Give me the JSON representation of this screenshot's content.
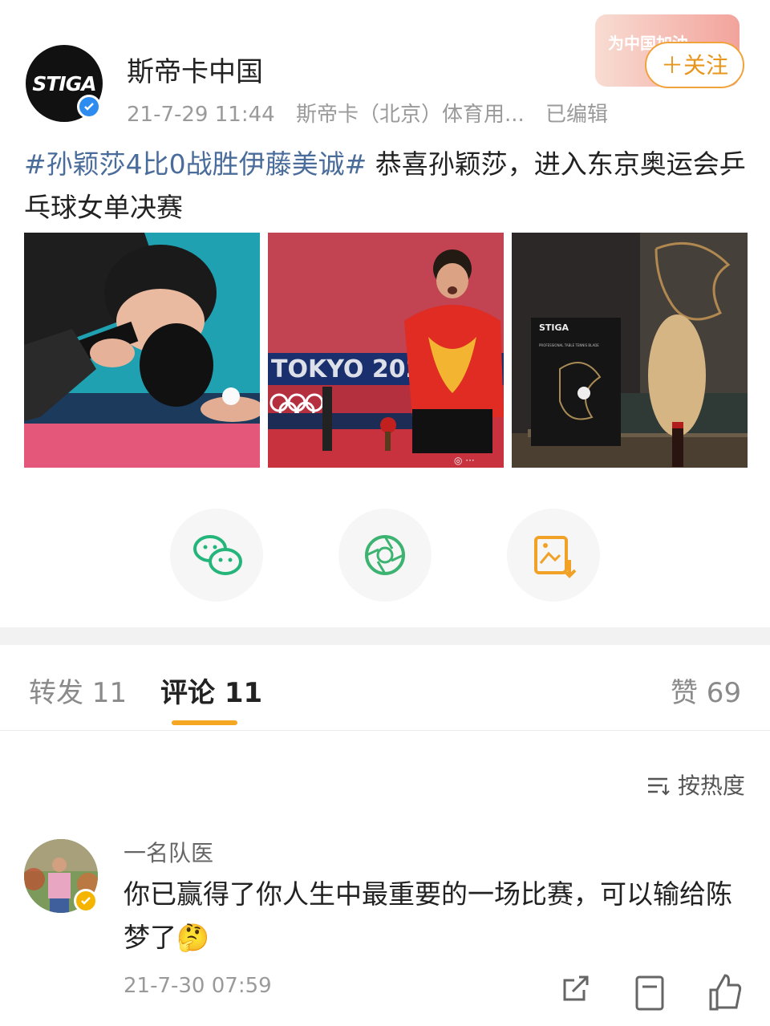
{
  "post": {
    "author": "斯帝卡中国",
    "avatar_logo": "STIGA",
    "timestamp": "21-7-29 11:44",
    "source": "斯帝卡（北京）体育用...",
    "edited": "已编辑",
    "follow_label": "＋关注",
    "decor_text": "为中国加油",
    "hashtag": "#孙颖莎4比0战胜伊藤美诚#",
    "text": " 恭喜孙颖莎，进入东京奥运会乒乓球女单决赛",
    "images": [
      "sun-yingsha-serving",
      "sun-yingsha-celebrating",
      "stiga-blade-product"
    ],
    "image_texts": {
      "tokyo": "TOKYO 2020",
      "box_brand": "STIGA",
      "box_label": "PROFESSIONAL TABLE TENNIS BLADE"
    },
    "share_buttons": [
      "wechat-icon",
      "moments-icon",
      "save-image-icon"
    ]
  },
  "tabs": {
    "repost": "转发 11",
    "comment": "评论 11",
    "like": "赞 69"
  },
  "sort_label": "按热度",
  "comment": {
    "user": "一名队医",
    "text": "你已赢得了你人生中最重要的一场比赛，可以输给陈梦了",
    "emoji": "🤔",
    "timestamp": "21-7-30 07:59",
    "actions": [
      "repost-icon",
      "comment-icon",
      "like-icon"
    ]
  },
  "colors": {
    "accent": "#f5a623",
    "link": "#4a6c9b",
    "verified": "#2d8cf0"
  }
}
